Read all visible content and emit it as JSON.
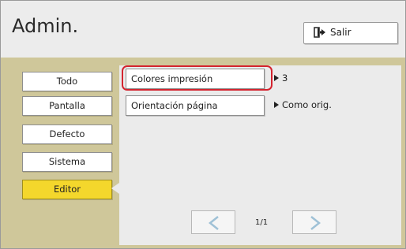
{
  "header": {
    "title": "Admin.",
    "exit_label": "Salir"
  },
  "sidebar": {
    "items": [
      {
        "label": "Todo",
        "active": false
      },
      {
        "label": "Pantalla",
        "active": false
      },
      {
        "label": "Defecto",
        "active": false
      },
      {
        "label": "Sistema",
        "active": false
      },
      {
        "label": "Editor",
        "active": true
      }
    ]
  },
  "settings": [
    {
      "label": "Colores impresión",
      "value": "3",
      "highlighted": true
    },
    {
      "label": "Orientación página",
      "value": "Como orig.",
      "highlighted": false
    }
  ],
  "pagination": {
    "page_text": "1/1",
    "prev_icon": "chevron-left-icon",
    "next_icon": "chevron-right-icon"
  },
  "colors": {
    "accent_active": "#f4d72c",
    "highlight_ring": "#d4242f",
    "body_bg": "#cfc79a"
  }
}
